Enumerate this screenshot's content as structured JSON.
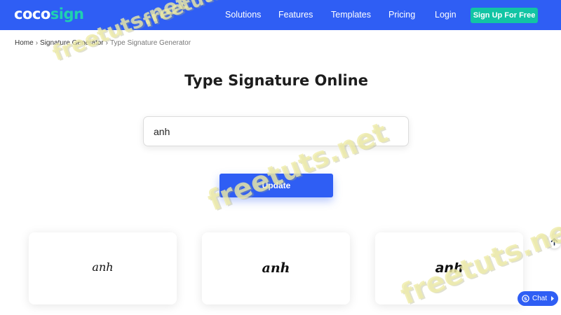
{
  "header": {
    "logo": {
      "part1": "coco",
      "part2": "sign"
    },
    "nav": [
      "Solutions",
      "Features",
      "Templates",
      "Pricing",
      "Login"
    ],
    "signup_label": "Sign Up For Free"
  },
  "breadcrumb": {
    "items": [
      "Home",
      "Signature Generator",
      "Type Signature Generator"
    ],
    "separator": "›"
  },
  "main": {
    "title": "Type Signature Online",
    "input_value": "anh",
    "update_label": "Update"
  },
  "signatures": [
    "anh",
    "anh",
    "anh"
  ],
  "chat": {
    "label": "Chat"
  },
  "watermark": "freetuts.net",
  "colors": {
    "primary": "#2f5ef4",
    "accent": "#12c4a4",
    "logo_accent": "#1fd1b0"
  },
  "icons": [
    "arrow-up-icon",
    "skype-icon",
    "chevron-right-icon"
  ]
}
